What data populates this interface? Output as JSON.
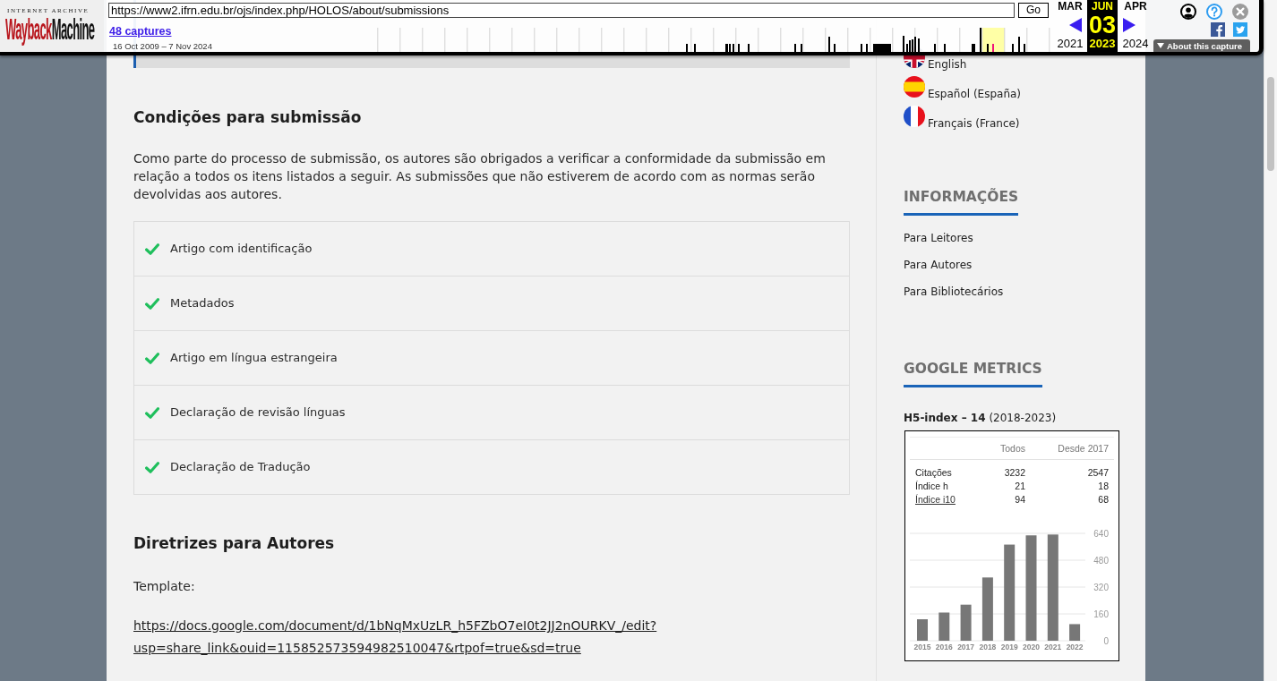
{
  "wayback_toolbar": {
    "logo": {
      "caption": "INTERNET ARCHIVE",
      "wordmark": [
        "Wayback",
        "Machine"
      ]
    },
    "url": "https://www2.ifrn.edu.br/ojs/index.php/HOLOS/about/submissions",
    "go_button": "Go",
    "captures_link": "48 captures",
    "capture_range": "16 Oct 2009 – 7 Nov 2024",
    "calendar": [
      {
        "month": "MAR",
        "year": "2021",
        "selected": false
      },
      {
        "month": "JUN",
        "day": "03",
        "year": "2023",
        "selected": true
      },
      {
        "month": "APR",
        "year": "2024",
        "selected": false
      }
    ],
    "about_button": "About this capture"
  },
  "submission_conditions": {
    "title": "Condições para submissão",
    "intro": "Como parte do processo de submissão, os autores são obrigados a verificar a conformidade da submissão em relação a todos os itens listados a seguir. As submissões que não estiverem de acordo com as normas serão devolvidas aos autores.",
    "checklist": [
      {
        "text": "Artigo com identificação",
        "checked": true
      },
      {
        "text": "Metadados",
        "checked": true
      },
      {
        "text": "Artigo em língua estrangeira",
        "checked": true
      },
      {
        "text": "Declaração de revisão línguas",
        "checked": true
      },
      {
        "text": "Declaração de Tradução",
        "checked": true
      }
    ]
  },
  "author_guidelines": {
    "title": "Diretrizes para Autores",
    "label": "Template:",
    "link": "https://docs.google.com/document/d/1bNqMxUzLR_h5FZbO7eI0t2JJ2nOURKV_/edit?usp=share_link&ouid=115852573594982510047&rtpof=true&sd=true"
  },
  "sidebar": {
    "languages": [
      {
        "label": "English",
        "kind": "uk"
      },
      {
        "label": "Español (España)",
        "kind": "es"
      },
      {
        "label": "Français (France)",
        "kind": "fr"
      }
    ],
    "information": {
      "title": "INFORMAÇÕES",
      "links": [
        "Para Leitores",
        "Para Autores",
        "Para Bibliotecários"
      ]
    },
    "google_metrics": {
      "title": "GOOGLE METRICS",
      "h5_index": "**H5-index – 14** (2018-2023)",
      "table": {
        "columns": [
          "Todos",
          "Desde 2017"
        ],
        "rows": [
          {
            "label": "Citações",
            "values": [
              "3232",
              "2547"
            ],
            "link": false
          },
          {
            "label": "Índice h",
            "values": [
              "21",
              "18"
            ],
            "link": false
          },
          {
            "label": "Índice i10",
            "values": [
              "94",
              "68"
            ],
            "link": true
          }
        ]
      },
      "chart_data": {
        "type": "bar",
        "categories": [
          "2015",
          "2016",
          "2017",
          "2018",
          "2019",
          "2020",
          "2021",
          "2022"
        ],
        "values": [
          128,
          168,
          215,
          377,
          573,
          628,
          633,
          99
        ],
        "ylim": [
          0,
          640
        ],
        "yticks": [
          0,
          160,
          320,
          480,
          640
        ],
        "grid": true
      }
    }
  }
}
